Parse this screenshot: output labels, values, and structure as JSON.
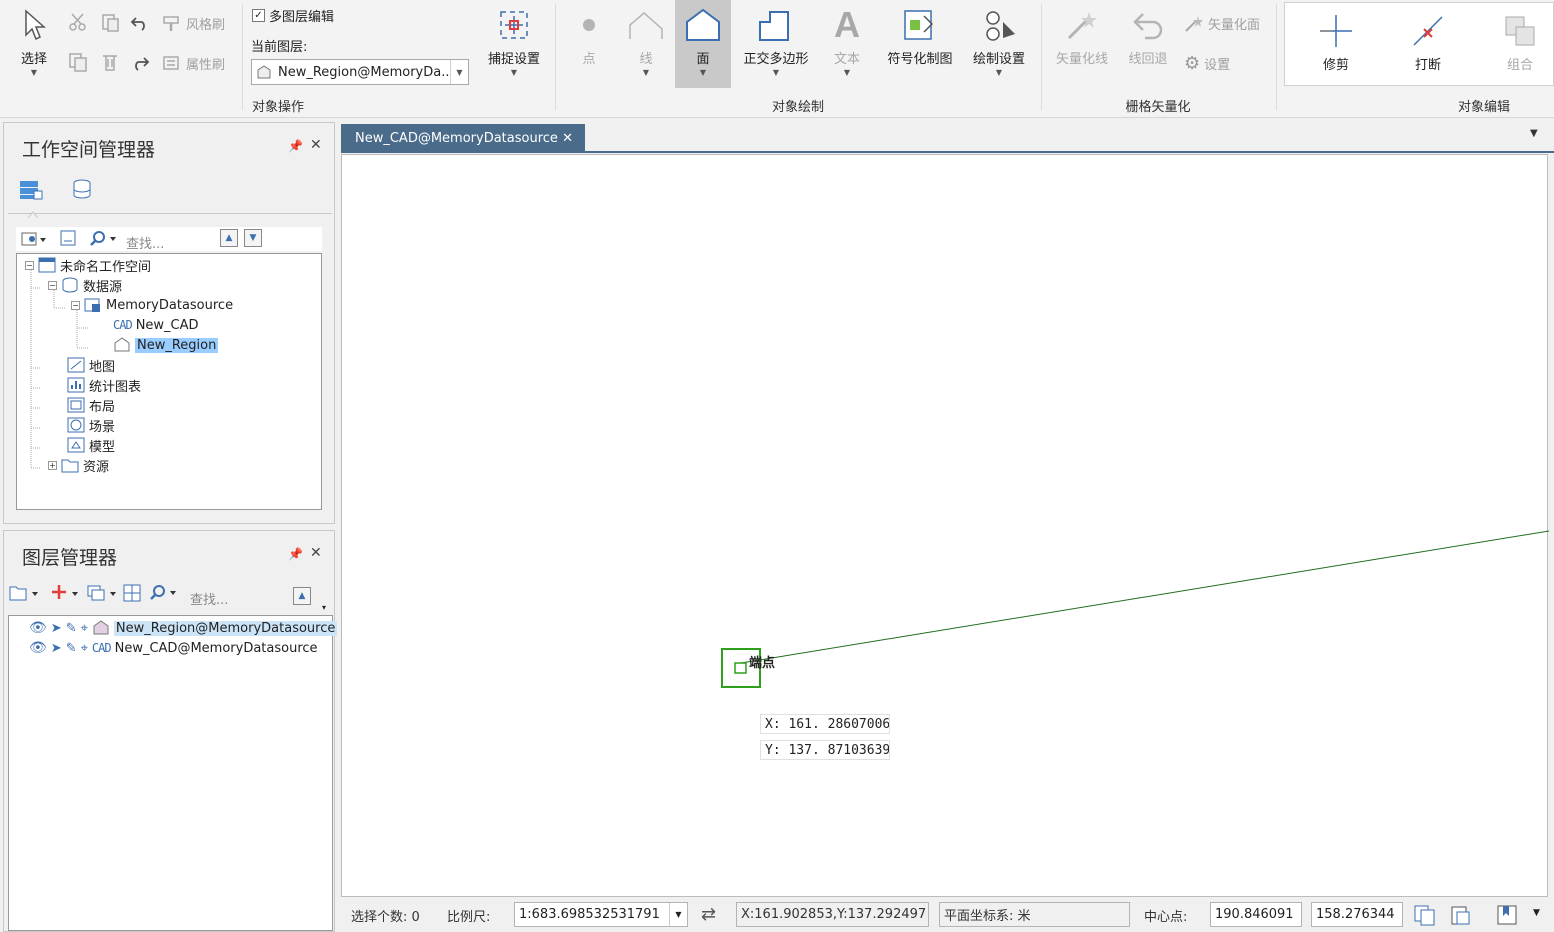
{
  "ribbon": {
    "select_label": "选择",
    "wind_brush_label": "风格刷",
    "attr_brush_label": "属性刷",
    "multi_layer_label": "多图层编辑",
    "current_layer_label": "当前图层:",
    "current_layer_value": "New_Region@MemoryDa...",
    "snap_settings_label": "捕捉设置",
    "group_object_ops": "对象操作",
    "point_label": "点",
    "line_label": "线",
    "face_label": "面",
    "ortho_polygon_label": "正交多边形",
    "text_label": "文本",
    "symbol_draw_label": "符号化制图",
    "draw_settings_label": "绘制设置",
    "group_object_draw": "对象绘制",
    "vectorize_line_label": "矢量化线",
    "line_rollback_label": "线回退",
    "vectorize_face_label": "矢量化面",
    "settings_label": "设置",
    "group_raster_vectorize": "栅格矢量化",
    "trim_label": "修剪",
    "break_label": "打断",
    "combine_label": "组合",
    "group_object_edit": "对象编辑"
  },
  "workspace_panel": {
    "title": "工作空间管理器",
    "search_placeholder": "查找...",
    "tree": {
      "root": "未命名工作空间",
      "datasources": "数据源",
      "memory_ds": "MemoryDatasource",
      "new_cad": "New_CAD",
      "new_region": "New_Region",
      "maps": "地图",
      "charts": "统计图表",
      "layouts": "布局",
      "scenes": "场景",
      "models": "模型",
      "resources": "资源"
    }
  },
  "layer_panel": {
    "title": "图层管理器",
    "search_placeholder": "查找...",
    "layers": [
      {
        "name": "New_Region@MemoryDatasource"
      },
      {
        "name": "New_CAD@MemoryDatasource"
      }
    ]
  },
  "document": {
    "tab_title": "New_CAD@MemoryDatasource",
    "snap_label": "端点",
    "x_readout": "X: 161. 286070066",
    "y_readout": "Y: 137. 871036390"
  },
  "status": {
    "selected_count": "选择个数: 0",
    "scale_label": "比例尺:",
    "scale_value": "1:683.698532531791",
    "cursor_coords": "X:161.902853,Y:137.292497",
    "coord_system": "平面坐标系: 米",
    "center_label": "中心点:",
    "center_x": "190.846091",
    "center_y": "158.276344"
  },
  "colors": {
    "accent": "#4a6b8a",
    "selection": "#99ccff",
    "snap_green": "#2ea01a",
    "line_green": "#1e6e1e"
  }
}
